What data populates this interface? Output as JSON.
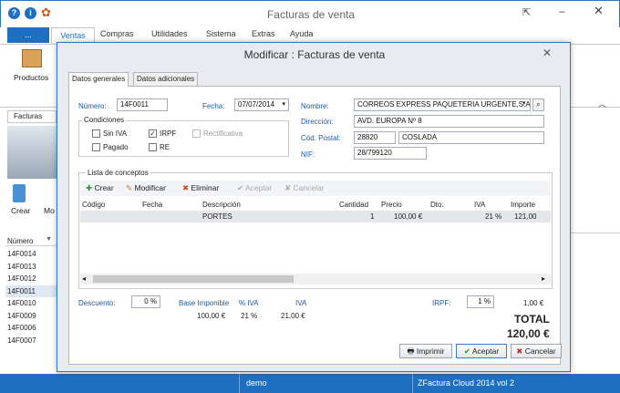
{
  "app": {
    "title": "Facturas de venta"
  },
  "ribbon": {
    "file_tab": "...",
    "tabs": [
      "Ventas",
      "Compras",
      "Utilidades",
      "Sistema",
      "Extras",
      "Ayuda"
    ],
    "productos_label": "Productos"
  },
  "left": {
    "doc_tab": "Facturas",
    "crear_label": "Crear",
    "mo_label": "Mo",
    "col_numero": "Número",
    "rows": [
      "14F0014",
      "14F0013",
      "14F0012",
      "14F0011",
      "14F0010",
      "14F0009",
      "14F0006",
      "14F0007"
    ]
  },
  "status": {
    "user": "demo",
    "product": "ZFactura Cloud 2014 vol 2"
  },
  "dialog": {
    "title": "Modificar : Facturas de venta",
    "tab_generales": "Datos generales",
    "tab_adicionales": "Datos adicionales",
    "numero_label": "Número:",
    "numero": "14F0011",
    "fecha_label": "Fecha:",
    "fecha": "07/07/2014",
    "condiciones_label": "Condiciones",
    "sin_iva": "Sin IVA",
    "irpf": "IRPF",
    "rectificativa": "Rectificativa",
    "pagado": "Pagado",
    "re": "RE",
    "nombre_label": "Nombre:",
    "nombre": "CORREOS EXPRESS PAQUETERIA URGENTE,S.A.",
    "direccion_label": "Dirección:",
    "direccion": "AVD. EUROPA Nº 8",
    "cp_label": "Cód. Postal:",
    "cp": "28820",
    "poblacion": "COSLADA",
    "nif_label": "NIF:",
    "nif": "28/799120",
    "conceptos_label": "Lista de conceptos",
    "toolbar": {
      "crear": "Crear",
      "modificar": "Modificar",
      "eliminar": "Eliminar",
      "aceptar": "Aceptar",
      "cancelar": "Cancelar"
    },
    "columns": {
      "codigo": "Código",
      "fecha": "Fecha",
      "descripcion": "Descripción",
      "cantidad": "Cantidad",
      "precio": "Precio",
      "dto": "Dto.",
      "iva": "IVA",
      "importe": "Importe"
    },
    "row": {
      "descripcion": "PORTES",
      "cantidad": "1",
      "precio": "100,00 €",
      "iva": "21 %",
      "importe": "121,00"
    },
    "descuento_label": "Descuento:",
    "descuento": "0 %",
    "base_label": "Base Imponible",
    "base": "100,00 €",
    "pct_iva_label": "% IVA",
    "pct_iva": "21 %",
    "iva_label": "IVA",
    "iva": "21,00 €",
    "irpf_label": "IRPF:",
    "irpf_pct": "1 %",
    "irpf_amount": "1,00 €",
    "total_label": "TOTAL",
    "total": "120,00 €",
    "imprimir": "Imprimir",
    "aceptar": "Aceptar",
    "cancelar": "Cancelar"
  },
  "colors": {
    "accent": "#1e6fbf",
    "label_blue": "#1e5aa6"
  }
}
